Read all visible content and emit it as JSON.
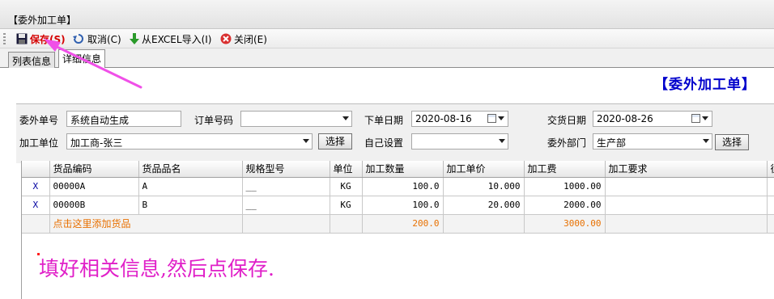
{
  "window": {
    "title": "【委外加工单】"
  },
  "toolbar": {
    "save_label": "保存(S)",
    "cancel_label": "取消(C)",
    "import_label": "从EXCEL导入(I)",
    "close_label": "关闭(E)"
  },
  "tabs": [
    {
      "label": "列表信息"
    },
    {
      "label": "详细信息"
    }
  ],
  "document": {
    "heading": "【委外加工单】"
  },
  "form": {
    "order_no_label": "委外单号",
    "order_no_value": "系统自动生成",
    "po_label": "订单号码",
    "po_value": "",
    "order_date_label": "下单日期",
    "order_date_value": "2020-08-16",
    "delivery_date_label": "交货日期",
    "delivery_date_value": "2020-08-26",
    "processor_label": "加工单位",
    "processor_value": "加工商-张三",
    "processor_button": "选择",
    "custom_label": "自己设置",
    "custom_value": "",
    "dept_label": "委外部门",
    "dept_value": "生产部",
    "dept_button": "选择"
  },
  "grid": {
    "columns": [
      "",
      "货品编码",
      "货品品名",
      "规格型号",
      "单位",
      "加工数量",
      "加工单价",
      "加工费",
      "加工要求",
      "征"
    ],
    "rows": [
      {
        "del": "X",
        "code": "00000A",
        "name": "A",
        "spec": "__",
        "unit": "KG",
        "qty": "100.0",
        "price": "10.000",
        "fee": "1000.00",
        "req": ""
      },
      {
        "del": "X",
        "code": "00000B",
        "name": "B",
        "spec": "__",
        "unit": "KG",
        "qty": "100.0",
        "price": "20.000",
        "fee": "2000.00",
        "req": ""
      }
    ],
    "total": {
      "add_link": "点击这里添加货品",
      "qty": "200.0",
      "fee": "3000.00"
    }
  },
  "annotation": {
    "text": "填好相关信息,然后点保存."
  },
  "colors": {
    "annotation": "#e020c8",
    "heading": "#0000cc",
    "save": "#d40000",
    "total": "#e87000"
  }
}
